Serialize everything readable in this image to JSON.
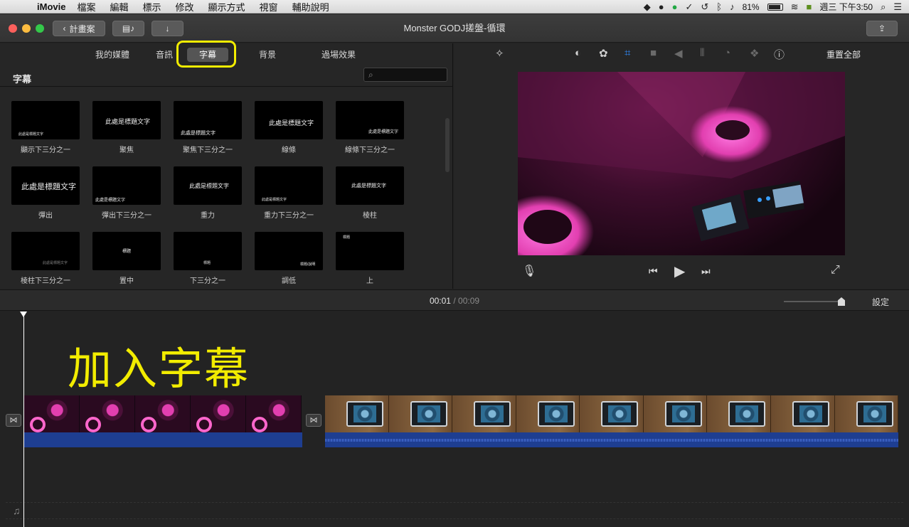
{
  "menubar": {
    "app_name": "iMovie",
    "menus": [
      "檔案",
      "編輯",
      "標示",
      "修改",
      "顯示方式",
      "視窗",
      "輔助說明"
    ],
    "battery": "81%",
    "clock": "週三 下午3:50"
  },
  "toolbar": {
    "back_label": "計畫案",
    "window_title": "Monster GODJ搓盤-循環"
  },
  "browser": {
    "tabs": [
      "我的媒體",
      "音訊",
      "字幕",
      "背景",
      "過場效果"
    ],
    "active_tab": "字幕",
    "section_title": "字幕",
    "search_placeholder": "",
    "titles": [
      {
        "label": "顯示下三分之一",
        "thumb_text": "此處是標題文字"
      },
      {
        "label": "聚焦",
        "thumb_text": "此處是標題文字"
      },
      {
        "label": "聚焦下三分之一",
        "thumb_text": "此處是標題文字"
      },
      {
        "label": "線條",
        "thumb_text": "此處是標題文字"
      },
      {
        "label": "線條下三分之一",
        "thumb_text": "此處是標題文字"
      },
      {
        "label": "彈出",
        "thumb_text": "此處是標題文字"
      },
      {
        "label": "彈出下三分之一",
        "thumb_text": "此處是標題文字"
      },
      {
        "label": "重力",
        "thumb_text": "此處是標題文字"
      },
      {
        "label": "重力下三分之一",
        "thumb_text": "此處是標題文字"
      },
      {
        "label": "棱柱",
        "thumb_text": "此處是標題文字"
      },
      {
        "label": "棱柱下三分之一",
        "thumb_text": "此處是標題文字"
      },
      {
        "label": "置中",
        "thumb_text": "標題"
      },
      {
        "label": "下三分之一",
        "thumb_text": "標題"
      },
      {
        "label": "調低",
        "thumb_text": "標題/說明"
      },
      {
        "label": "上",
        "thumb_text": "標題"
      }
    ]
  },
  "viewer": {
    "reset_all": "重置全部",
    "adjust_icons": [
      "magic-wand-icon",
      "color-balance-icon",
      "color-palette-icon",
      "crop-icon",
      "stabilization-icon",
      "volume-icon",
      "equalizer-icon",
      "speed-icon",
      "overlay-icon",
      "info-icon"
    ]
  },
  "timeline": {
    "current_time": "00:01",
    "separator": "/",
    "total_time": "00:09",
    "settings_label": "設定",
    "overlay_caption": "加入字幕"
  },
  "colors": {
    "highlight": "#f2ec00",
    "accent_blue": "#2f8cff",
    "audio_blue": "#1e3e91"
  }
}
